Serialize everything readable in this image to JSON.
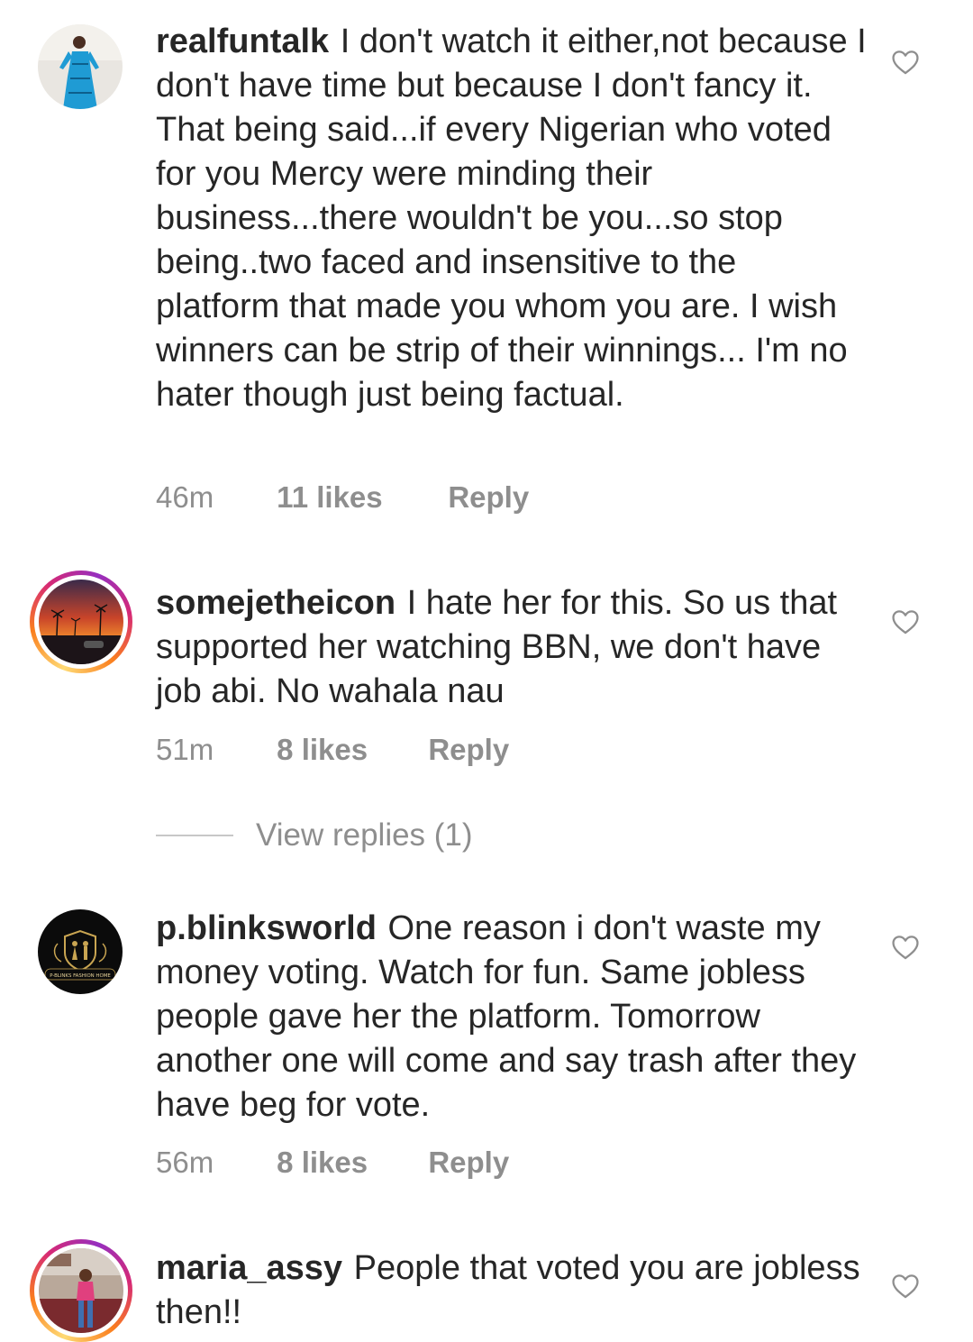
{
  "comments": [
    {
      "username": "realfuntalk",
      "text": "I don't watch it either,not because I don't have time but because I don't fancy it. That being said...if every Nigerian who voted for you Mercy were minding their business...there wouldn't be you...so stop being..two faced and insensitive to the platform that made you whom you are. I wish winners can be strip of their winnings... I'm no hater though just being factual.",
      "time": "46m",
      "likes": "11 likes",
      "reply": "Reply",
      "avatar_icon": "person-in-blue-dress-avatar"
    },
    {
      "username": "somejetheicon",
      "text": "I hate her for this. So us that supported her watching BBN, we don't have job abi. No wahala nau",
      "time": "51m",
      "likes": "8 likes",
      "reply": "Reply",
      "avatar_icon": "sunset-palm-trees-avatar",
      "view_replies": "View replies (1)"
    },
    {
      "username": "p.blinksworld",
      "text": "One reason i don't waste my money voting. Watch for fun. Same jobless people gave her the platform. Tomorrow another one will come and say trash after they have beg for vote.",
      "time": "56m",
      "likes": "8 likes",
      "reply": "Reply",
      "avatar_icon": "fashion-home-logo-avatar",
      "avatar_logo_text": "P-BLINKS FASHION HOME"
    },
    {
      "username": "maria_assy",
      "text": "People that voted you are jobless then!!",
      "avatar_icon": "person-in-pink-avatar"
    }
  ],
  "colors": {
    "text": "#262626",
    "meta": "#8e8e8e",
    "story_ring": [
      "#feda75",
      "#fa7e1e",
      "#d62976",
      "#962fbf"
    ]
  },
  "icons": {
    "like": "heart-outline-icon"
  }
}
